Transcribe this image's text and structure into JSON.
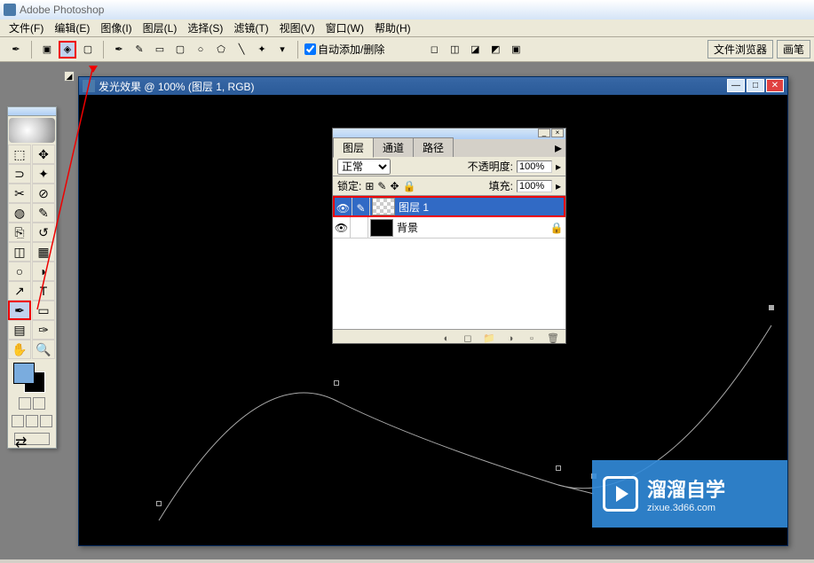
{
  "app": {
    "title": "Adobe Photoshop"
  },
  "menu": {
    "file": "文件(F)",
    "edit": "编辑(E)",
    "image": "图像(I)",
    "layer": "图层(L)",
    "select": "选择(S)",
    "filter": "滤镜(T)",
    "view": "视图(V)",
    "window": "窗口(W)",
    "help": "帮助(H)"
  },
  "options": {
    "autoAddDelete": "自动添加/删除",
    "fileBrowser": "文件浏览器",
    "brushes": "画笔"
  },
  "doc": {
    "title": "发光效果 @ 100% (图层 1, RGB)"
  },
  "layersPanel": {
    "tabLayers": "图层",
    "tabChannels": "通道",
    "tabPaths": "路径",
    "blendMode": "正常",
    "opacityLabel": "不透明度:",
    "opacityValue": "100%",
    "lockLabel": "锁定:",
    "fillLabel": "填充:",
    "fillValue": "100%",
    "layers": [
      {
        "name": "图层 1"
      },
      {
        "name": "背景"
      }
    ]
  },
  "watermark": {
    "title": "溜溜自学",
    "sub": "zixue.3d66.com"
  },
  "icons": {
    "marquee": "⬚",
    "move": "✥",
    "lasso": "⊃",
    "wand": "✦",
    "crop": "✂",
    "slice": "⊘",
    "heal": "◍",
    "brush": "✎",
    "stamp": "⎘",
    "history": "↺",
    "eraser": "◫",
    "gradient": "▦",
    "blur": "○",
    "dodge": "◗",
    "path": "↗",
    "type": "T",
    "pen": "✒",
    "shape": "▭",
    "notes": "📝",
    "eyedrop": "✑",
    "hand": "✋",
    "zoom": "🔍"
  }
}
